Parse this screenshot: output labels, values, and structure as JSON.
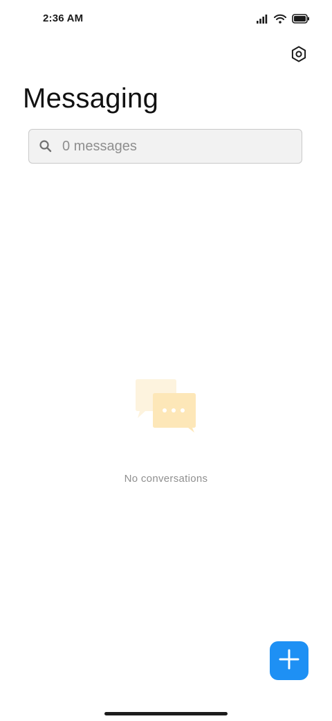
{
  "status_bar": {
    "time": "2:36 AM",
    "icons": [
      "signal-icon",
      "wifi-icon",
      "battery-icon"
    ]
  },
  "header": {
    "settings_icon": "settings-icon",
    "title": "Messaging"
  },
  "search": {
    "placeholder": "0 messages",
    "value": "",
    "icon": "search-icon"
  },
  "empty_state": {
    "illustration": "chat-bubbles-icon",
    "text": "No conversations"
  },
  "fab": {
    "icon": "plus-icon",
    "color": "#1e90f4"
  },
  "colors": {
    "accent": "#1e90f4",
    "illustration_light": "#fdf3de",
    "illustration_dark": "#fde7b8"
  }
}
